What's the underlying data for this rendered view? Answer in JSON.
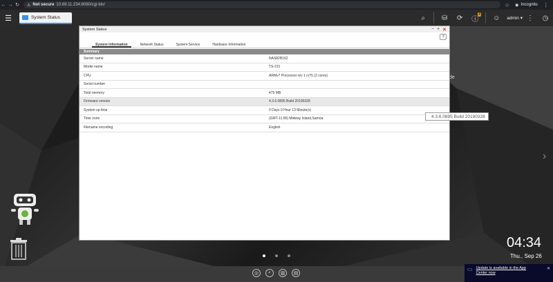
{
  "browser": {
    "security_label": "Not secure",
    "url": "10.69.11.234:8080/cgi-bin/",
    "profile_label": "Incognito"
  },
  "topbar": {
    "task_label": "System Status",
    "notification_badge": "8",
    "user_label": "admin"
  },
  "window": {
    "title": "System Status",
    "help_label": "?",
    "tabs": [
      {
        "label": "System Information",
        "active": true
      },
      {
        "label": "Network Status",
        "active": false
      },
      {
        "label": "System Service",
        "active": false
      },
      {
        "label": "Hardware Information",
        "active": false
      }
    ],
    "section_header": "Summary",
    "rows": [
      {
        "label": "Server name",
        "value": "NAS82B162"
      },
      {
        "label": "Model name",
        "value": "TS-231"
      },
      {
        "label": "CPU",
        "value": "ARMv7 Processor rev 1 (v7l) (2 cores)"
      },
      {
        "label": "Serial number",
        "value": ""
      },
      {
        "label": "Total memory",
        "value": "479 MB"
      },
      {
        "label": "Firmware version",
        "value": "4.3.6.0895 Build 20190328"
      },
      {
        "label": "System up time",
        "value": "0 Days 0 Hour 13 Minute(s)"
      },
      {
        "label": "Time zone",
        "value": "(GMT-11:00) Midway Island,Samoa"
      },
      {
        "label": "Filename encoding",
        "value": "English"
      }
    ]
  },
  "tooltip": "4.3.6.0895 Build 20190328",
  "desktop": {
    "side_label": "de",
    "clock": "04:34",
    "date": "Thu., Sep 26"
  },
  "notification": {
    "message": "Update is available in the App Center now"
  },
  "colors": {
    "accent": "#3b93e0",
    "close": "#d9381e",
    "badge": "#f39c12"
  }
}
